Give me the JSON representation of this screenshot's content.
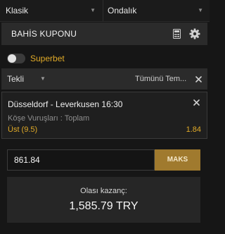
{
  "top_selects": {
    "market_type": "Klasik",
    "odds_format": "Ondalık"
  },
  "icons": {
    "caret": "caret-down-icon",
    "calculator": "calculator-icon",
    "settings": "gear-icon",
    "close": "close-icon"
  },
  "header": {
    "title": "BAHİS KUPONU"
  },
  "superbet": {
    "label": "Superbet",
    "enabled": false
  },
  "bet_type": {
    "selected": "Tekli",
    "clear_all_label": "Tümünü Tem..."
  },
  "bet": {
    "match": "Düsseldorf - Leverkusen 16:30",
    "market": "Köşe Vuruşları : Toplam",
    "selection": "Üst (9.5)",
    "odds": "1.84"
  },
  "stake": {
    "value": "861.84",
    "max_label": "MAKS"
  },
  "payout": {
    "label": "Olası kazanç:",
    "value": "1,585.79 TRY"
  },
  "colors": {
    "accent": "#e0aa28",
    "max_button": "#a07a2e",
    "background": "#161616",
    "panel": "#2b2b2b"
  }
}
